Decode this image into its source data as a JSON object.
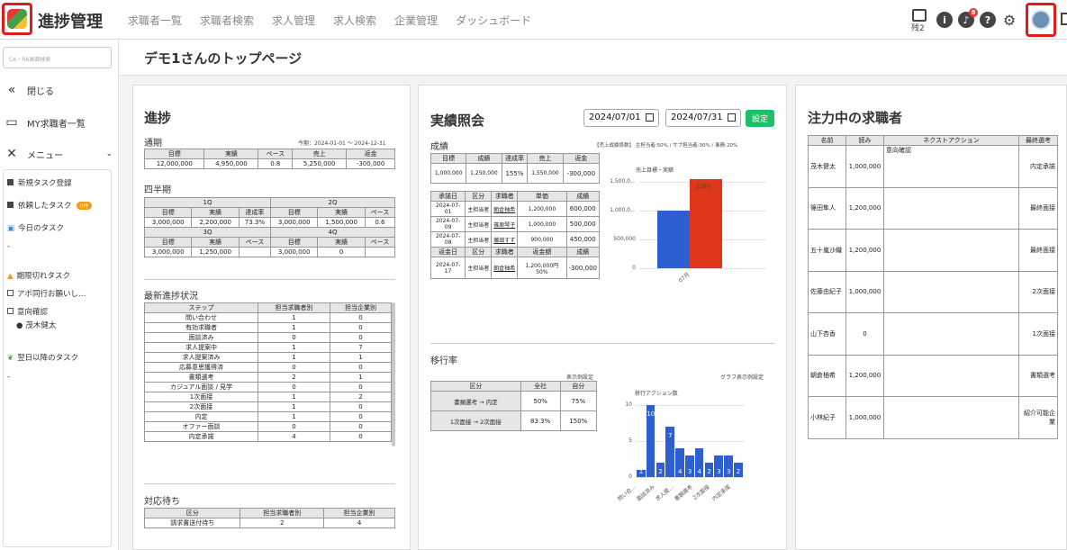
{
  "app": {
    "title": "進捗管理",
    "nav": [
      "求職者一覧",
      "求職者検索",
      "求人管理",
      "求人検索",
      "企業管理",
      "ダッシュボード"
    ],
    "remaining": "残2",
    "notif_count": "8"
  },
  "sidebar": {
    "search_placeholder": "CA・RA画面検索",
    "close": "閉じる",
    "my_seekers": "MY求職者一覧",
    "menu": "メニュー",
    "new_task": "新規タスク登録",
    "requested": "依頼したタスク",
    "requested_badge": "0件",
    "today": "今日のタスク",
    "today_val": "-",
    "expired": "期限切れタスク",
    "expired_items": [
      "アポ同行お願いし…",
      "意向確認"
    ],
    "expired_person": "茂木健太",
    "next": "翌日以降のタスク",
    "next_val": "-"
  },
  "page_title": "デモ1さんのトップページ",
  "progress": {
    "title": "進捗",
    "period_label": "通期",
    "period_range": "今期：2024-01-01 〜 2024-12-31",
    "annual": {
      "headers": [
        "目標",
        "実績",
        "ペース",
        "売上",
        "返金"
      ],
      "row": [
        "12,000,000",
        "4,950,000",
        "0.8",
        "5,250,000",
        "-300,000"
      ]
    },
    "quarter_label": "四半期",
    "q1": "1Q",
    "q2": "2Q",
    "q3": "3Q",
    "q4": "4Q",
    "qh1": [
      "目標",
      "実績",
      "達成率",
      "目標",
      "実績",
      "ペース"
    ],
    "qr1": [
      "3,000,000",
      "2,200,000",
      "73.3%",
      "3,000,000",
      "1,500,000",
      "0.6"
    ],
    "qh2": [
      "目標",
      "実績",
      "ペース",
      "目標",
      "実績",
      "ペース"
    ],
    "qr2": [
      "3,000,000",
      "1,250,000",
      "",
      "3,000,000",
      "0",
      ""
    ],
    "latest_label": "最新進捗状況",
    "latest_headers": [
      "ステップ",
      "担当求職者別",
      "担当企業別"
    ],
    "latest_rows": [
      [
        "問い合わせ",
        "1",
        "0"
      ],
      [
        "有効求職者",
        "1",
        "0"
      ],
      [
        "面談済み",
        "0",
        "0"
      ],
      [
        "求人提案中",
        "1",
        "7"
      ],
      [
        "求人提案済み",
        "1",
        "1"
      ],
      [
        "応募意思獲得済",
        "0",
        "0"
      ],
      [
        "書類選考",
        "2",
        "1"
      ],
      [
        "カジュアル面談 / 見学",
        "0",
        "0"
      ],
      [
        "1次面接",
        "1",
        "2"
      ],
      [
        "2次面接",
        "1",
        "0"
      ],
      [
        "内定",
        "1",
        "0"
      ],
      [
        "オファー面談",
        "0",
        "0"
      ],
      [
        "内定承諾",
        "4",
        "0"
      ]
    ],
    "waiting_label": "対応待ち",
    "waiting_headers": [
      "区分",
      "担当求職者別",
      "担当企業別"
    ],
    "waiting_row": [
      "請求書送付待ち",
      "2",
      "4"
    ]
  },
  "results": {
    "title": "実績照会",
    "date_from": "2024/07/01",
    "date_to": "2024/07/31",
    "set_label": "設定",
    "seiseki_label": "成績",
    "note": "【売上成績係数】 主担当者:50% / サブ担当者:30% / 事務:20%",
    "sh": [
      "目標",
      "成績",
      "達成率",
      "売上",
      "返金"
    ],
    "sr": [
      "1,000,000",
      "1,250,000",
      "155%",
      "1,550,000",
      "-300,000"
    ],
    "dh": [
      "承諾日",
      "区分",
      "求職者",
      "単価",
      "成績"
    ],
    "dr": [
      [
        "2024-07-01",
        "主担当者",
        "朝倉柚希",
        "1,200,000",
        "600,000"
      ],
      [
        "2024-07-09",
        "主担当者",
        "篠原琴子",
        "1,000,000",
        "500,000"
      ],
      [
        "2024-07-08",
        "主担当者",
        "藤田すず",
        "900,000",
        "450,000"
      ]
    ],
    "rh": [
      "返金日",
      "区分",
      "求職者",
      "返金額",
      "成績"
    ],
    "rr": [
      "2024-07-17",
      "主担当者",
      "朝倉柚希",
      "1,200,000円 50%",
      "-300,000"
    ],
    "chart_title": "売上目標・実績",
    "chart_x": "07月",
    "chart_pct": "155%",
    "transition_label": "移行率",
    "display_setting": "表示例設定",
    "graph_setting": "グラフ表示例設定",
    "th": [
      "区分",
      "全社",
      "自分"
    ],
    "tr": [
      [
        "書類選考 → 内定",
        "50%",
        "75%"
      ],
      [
        "1次面接 → 2次面接",
        "83.3%",
        "150%"
      ]
    ],
    "bar_title": "移行アクション数",
    "bar_xlabels": [
      "問い合…",
      "面談済み",
      "求人提…",
      "書類選考",
      "2次面接",
      "内定承諾"
    ]
  },
  "focus": {
    "title": "注力中の求職者",
    "headers": [
      "名前",
      "読み",
      "ネクストアクション",
      "最終選考"
    ],
    "rows": [
      [
        "茂木健太",
        "1,000,000",
        "意向確認",
        "内定承諾"
      ],
      [
        "篠田隼人",
        "1,200,000",
        "",
        "最終面接"
      ],
      [
        "五十嵐沙織",
        "1,200,000",
        "",
        "最終面接"
      ],
      [
        "佐藤由紀子",
        "1,000,000",
        "",
        "2次面接"
      ],
      [
        "山下杏香",
        "0",
        "",
        "1次面接"
      ],
      [
        "朝倉柚希",
        "1,200,000",
        "",
        "書類選考"
      ],
      [
        "小林紀子",
        "1,000,000",
        "",
        "紹介可能企業"
      ]
    ]
  },
  "chart_data": [
    {
      "type": "bar",
      "title": "売上目標・実績",
      "categories": [
        "07月"
      ],
      "series": [
        {
          "values": [
            1000000
          ]
        },
        {
          "values": [
            1550000
          ]
        }
      ],
      "ylim": [
        0,
        1500000
      ],
      "yticks": [
        "1,500,0…",
        "1,000,0…",
        "500,000",
        "0"
      ],
      "annotations": [
        "155%"
      ],
      "colors": [
        "#2e5fd0",
        "#e0371b"
      ]
    },
    {
      "type": "bar",
      "title": "移行アクション数",
      "values": [
        1,
        10,
        2,
        7,
        4,
        3,
        4,
        2,
        3,
        3,
        2
      ],
      "ylim": [
        0,
        10
      ],
      "yticks": [
        "10",
        "5",
        "0"
      ],
      "color": "#2e5fd0"
    }
  ]
}
